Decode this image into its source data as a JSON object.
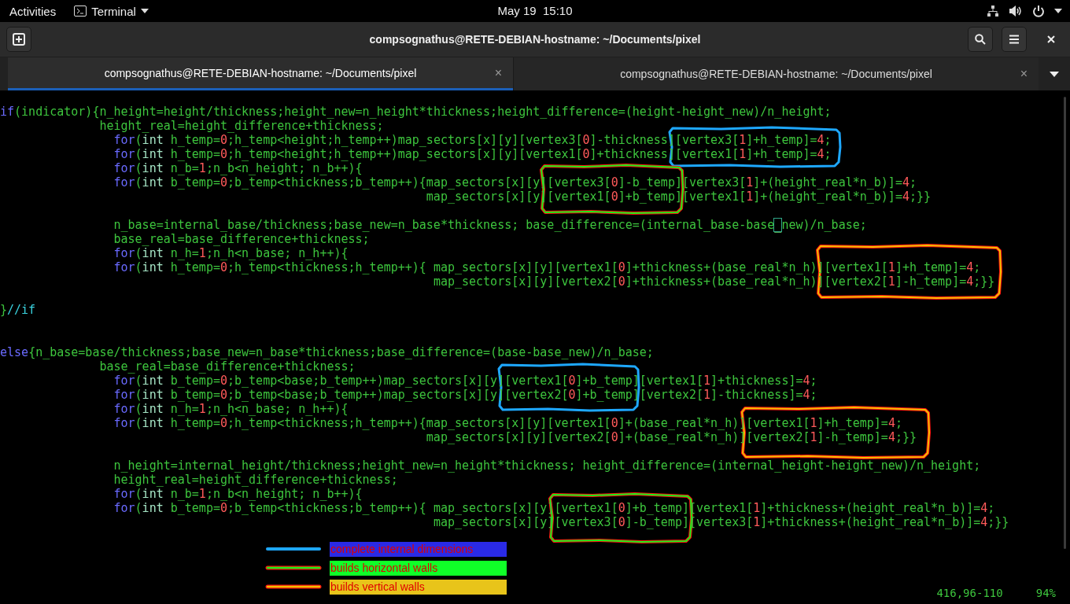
{
  "top_bar": {
    "activities": "Activities",
    "app_menu": "Terminal",
    "clock": "May 19  15:10"
  },
  "window": {
    "title": "compsognathus@RETE-DEBIAN-hostname: ~/Documents/pixel"
  },
  "tabs": [
    {
      "label": "compsognathus@RETE-DEBIAN-hostname: ~/Documents/pixel",
      "selected": true,
      "close": "×"
    },
    {
      "label": "compsognathus@RETE-DEBIAN-hostname: ~/Documents/pixel",
      "selected": false,
      "close": "×"
    }
  ],
  "code_lines": [
    {
      "kind": "top",
      "segments": [
        {
          "kind": "keyword",
          "text": "if"
        },
        {
          "kind": "plain",
          "text": "(indicator){n_height=height/thickness;height_new=n_height*thickness;height_difference=(height-height_new)/n_height;"
        }
      ]
    },
    {
      "kind": "block",
      "segments": [
        {
          "kind": "plain",
          "text": "height_real=height_difference+thickness;"
        }
      ]
    },
    {
      "kind": "statement",
      "segments": [
        {
          "kind": "keyword",
          "text": "for"
        },
        {
          "kind": "plain",
          "text": "("
        },
        {
          "kind": "type",
          "text": "int"
        },
        {
          "kind": "plain",
          "text": " h_temp="
        },
        {
          "kind": "number",
          "text": "0"
        },
        {
          "kind": "plain",
          "text": ";h_temp<height;h_temp++)map_sectors[x][y][vertex3["
        },
        {
          "kind": "number",
          "text": "0"
        },
        {
          "kind": "plain",
          "text": "]-thickness][vertex3["
        },
        {
          "kind": "number",
          "text": "1"
        },
        {
          "kind": "plain",
          "text": "]+h_temp]="
        },
        {
          "kind": "number",
          "text": "4"
        },
        {
          "kind": "plain",
          "text": ";"
        }
      ]
    },
    {
      "kind": "statement",
      "segments": [
        {
          "kind": "keyword",
          "text": "for"
        },
        {
          "kind": "plain",
          "text": "("
        },
        {
          "kind": "type",
          "text": "int"
        },
        {
          "kind": "plain",
          "text": " h_temp="
        },
        {
          "kind": "number",
          "text": "0"
        },
        {
          "kind": "plain",
          "text": ";h_temp<height;h_temp++)map_sectors[x][y][vertex1["
        },
        {
          "kind": "number",
          "text": "0"
        },
        {
          "kind": "plain",
          "text": "]+thickness][vertex1["
        },
        {
          "kind": "number",
          "text": "1"
        },
        {
          "kind": "plain",
          "text": "]+h_temp]="
        },
        {
          "kind": "number",
          "text": "4"
        },
        {
          "kind": "plain",
          "text": ";"
        }
      ]
    },
    {
      "kind": "statement",
      "segments": [
        {
          "kind": "keyword",
          "text": "for"
        },
        {
          "kind": "plain",
          "text": "("
        },
        {
          "kind": "type",
          "text": "int"
        },
        {
          "kind": "plain",
          "text": " n_b="
        },
        {
          "kind": "number",
          "text": "1"
        },
        {
          "kind": "plain",
          "text": ";n_b<n_height; n_b++){"
        }
      ]
    },
    {
      "kind": "statement",
      "segments": [
        {
          "kind": "keyword",
          "text": "for"
        },
        {
          "kind": "plain",
          "text": "("
        },
        {
          "kind": "type",
          "text": "int"
        },
        {
          "kind": "plain",
          "text": " b_temp="
        },
        {
          "kind": "number",
          "text": "0"
        },
        {
          "kind": "plain",
          "text": ";b_temp<thickness;b_temp++){map_sectors[x][y][vertex3["
        },
        {
          "kind": "number",
          "text": "0"
        },
        {
          "kind": "plain",
          "text": "]-b_temp][vertex3["
        },
        {
          "kind": "number",
          "text": "1"
        },
        {
          "kind": "plain",
          "text": "]+(height_real*n_b)]="
        },
        {
          "kind": "number",
          "text": "4"
        },
        {
          "kind": "plain",
          "text": ";"
        }
      ]
    },
    {
      "kind": "wrap",
      "segments": [
        {
          "kind": "plain",
          "text": "map_sectors[x][y][vertex1["
        },
        {
          "kind": "number",
          "text": "0"
        },
        {
          "kind": "plain",
          "text": "]+b_temp][vertex1["
        },
        {
          "kind": "number",
          "text": "1"
        },
        {
          "kind": "plain",
          "text": "]+(height_real*n_b)]="
        },
        {
          "kind": "number",
          "text": "4"
        },
        {
          "kind": "plain",
          "text": ";}}"
        }
      ]
    },
    {
      "kind": "blank"
    },
    {
      "kind": "statement",
      "segments": [
        {
          "kind": "plain",
          "text": "n_base=internal_base/thickness;base_new=n_base*thickness; base_difference=(internal_base-base"
        },
        {
          "kind": "cursor",
          "text": "_"
        },
        {
          "kind": "plain",
          "text": "new)/n_base;"
        }
      ]
    },
    {
      "kind": "statement",
      "segments": [
        {
          "kind": "plain",
          "text": "base_real=base_difference+thickness;"
        }
      ]
    },
    {
      "kind": "statement",
      "segments": [
        {
          "kind": "keyword",
          "text": "for"
        },
        {
          "kind": "plain",
          "text": "("
        },
        {
          "kind": "type",
          "text": "int"
        },
        {
          "kind": "plain",
          "text": " n_h="
        },
        {
          "kind": "number",
          "text": "1"
        },
        {
          "kind": "plain",
          "text": ";n_h<n_base; n_h++){"
        }
      ]
    },
    {
      "kind": "statement",
      "segments": [
        {
          "kind": "keyword",
          "text": "for"
        },
        {
          "kind": "plain",
          "text": "("
        },
        {
          "kind": "type",
          "text": "int"
        },
        {
          "kind": "plain",
          "text": " h_temp="
        },
        {
          "kind": "number",
          "text": "0"
        },
        {
          "kind": "plain",
          "text": ";h_temp<thickness;h_temp++){ map_sectors[x][y][vertex1["
        },
        {
          "kind": "number",
          "text": "0"
        },
        {
          "kind": "plain",
          "text": "]+thickness+(base_real*n_h)][vertex1["
        },
        {
          "kind": "number",
          "text": "1"
        },
        {
          "kind": "plain",
          "text": "]+h_temp]="
        },
        {
          "kind": "number",
          "text": "4"
        },
        {
          "kind": "plain",
          "text": ";"
        }
      ]
    },
    {
      "kind": "wrap_wide",
      "segments": [
        {
          "kind": "plain",
          "text": "map_sectors[x][y][vertex2["
        },
        {
          "kind": "number",
          "text": "0"
        },
        {
          "kind": "plain",
          "text": "]+thickness+(base_real*n_h)][vertex2["
        },
        {
          "kind": "number",
          "text": "1"
        },
        {
          "kind": "plain",
          "text": "]-h_temp]="
        },
        {
          "kind": "number",
          "text": "4"
        },
        {
          "kind": "plain",
          "text": ";}}"
        }
      ]
    },
    {
      "kind": "blank"
    },
    {
      "kind": "top",
      "segments": [
        {
          "kind": "plain",
          "text": "}"
        },
        {
          "kind": "comment",
          "text": "//if"
        }
      ]
    },
    {
      "kind": "blank"
    },
    {
      "kind": "blank"
    },
    {
      "kind": "top",
      "segments": [
        {
          "kind": "keyword",
          "text": "else"
        },
        {
          "kind": "plain",
          "text": "{n_base=base/thickness;base_new=n_base*thickness;base_difference=(base-base_new)/n_base;"
        }
      ]
    },
    {
      "kind": "block",
      "segments": [
        {
          "kind": "plain",
          "text": "base_real=base_difference+thickness;"
        }
      ]
    },
    {
      "kind": "statement",
      "segments": [
        {
          "kind": "keyword",
          "text": "for"
        },
        {
          "kind": "plain",
          "text": "("
        },
        {
          "kind": "type",
          "text": "int"
        },
        {
          "kind": "plain",
          "text": " b_temp="
        },
        {
          "kind": "number",
          "text": "0"
        },
        {
          "kind": "plain",
          "text": ";b_temp<base;b_temp++)map_sectors[x][y][vertex1["
        },
        {
          "kind": "number",
          "text": "0"
        },
        {
          "kind": "plain",
          "text": "]+b_temp][vertex1["
        },
        {
          "kind": "number",
          "text": "1"
        },
        {
          "kind": "plain",
          "text": "]+thickness]="
        },
        {
          "kind": "number",
          "text": "4"
        },
        {
          "kind": "plain",
          "text": ";"
        }
      ]
    },
    {
      "kind": "statement",
      "segments": [
        {
          "kind": "keyword",
          "text": "for"
        },
        {
          "kind": "plain",
          "text": "("
        },
        {
          "kind": "type",
          "text": "int"
        },
        {
          "kind": "plain",
          "text": " b_temp="
        },
        {
          "kind": "number",
          "text": "0"
        },
        {
          "kind": "plain",
          "text": ";b_temp<base;b_temp++)map_sectors[x][y][vertex2["
        },
        {
          "kind": "number",
          "text": "0"
        },
        {
          "kind": "plain",
          "text": "]+b_temp][vertex2["
        },
        {
          "kind": "number",
          "text": "1"
        },
        {
          "kind": "plain",
          "text": "]-thickness]="
        },
        {
          "kind": "number",
          "text": "4"
        },
        {
          "kind": "plain",
          "text": ";"
        }
      ]
    },
    {
      "kind": "statement",
      "segments": [
        {
          "kind": "keyword",
          "text": "for"
        },
        {
          "kind": "plain",
          "text": "("
        },
        {
          "kind": "type",
          "text": "int"
        },
        {
          "kind": "plain",
          "text": " n_h="
        },
        {
          "kind": "number",
          "text": "1"
        },
        {
          "kind": "plain",
          "text": ";n_h<n_base; n_h++){"
        }
      ]
    },
    {
      "kind": "statement",
      "segments": [
        {
          "kind": "keyword",
          "text": "for"
        },
        {
          "kind": "plain",
          "text": "("
        },
        {
          "kind": "type",
          "text": "int"
        },
        {
          "kind": "plain",
          "text": " h_temp="
        },
        {
          "kind": "number",
          "text": "0"
        },
        {
          "kind": "plain",
          "text": ";h_temp<thickness;h_temp++){map_sectors[x][y][vertex1["
        },
        {
          "kind": "number",
          "text": "0"
        },
        {
          "kind": "plain",
          "text": "]+(base_real*n_h)][vertex1["
        },
        {
          "kind": "number",
          "text": "1"
        },
        {
          "kind": "plain",
          "text": "]+h_temp]="
        },
        {
          "kind": "number",
          "text": "4"
        },
        {
          "kind": "plain",
          "text": ";"
        }
      ]
    },
    {
      "kind": "wrap",
      "segments": [
        {
          "kind": "plain",
          "text": "map_sectors[x][y][vertex2["
        },
        {
          "kind": "number",
          "text": "0"
        },
        {
          "kind": "plain",
          "text": "]+(base_real*n_h)][vertex2["
        },
        {
          "kind": "number",
          "text": "1"
        },
        {
          "kind": "plain",
          "text": "]-h_temp]="
        },
        {
          "kind": "number",
          "text": "4"
        },
        {
          "kind": "plain",
          "text": ";}}"
        }
      ]
    },
    {
      "kind": "blank"
    },
    {
      "kind": "statement",
      "segments": [
        {
          "kind": "plain",
          "text": "n_height=internal_height/thickness;height_new=n_height*thickness; height_difference=(internal_height-height_new)/n_height;"
        }
      ]
    },
    {
      "kind": "statement",
      "segments": [
        {
          "kind": "plain",
          "text": "height_real=height_difference+thickness;"
        }
      ]
    },
    {
      "kind": "statement",
      "segments": [
        {
          "kind": "keyword",
          "text": "for"
        },
        {
          "kind": "plain",
          "text": "("
        },
        {
          "kind": "type",
          "text": "int"
        },
        {
          "kind": "plain",
          "text": " n_b="
        },
        {
          "kind": "number",
          "text": "1"
        },
        {
          "kind": "plain",
          "text": ";n_b<n_height; n_b++){"
        }
      ]
    },
    {
      "kind": "statement",
      "segments": [
        {
          "kind": "keyword",
          "text": "for"
        },
        {
          "kind": "plain",
          "text": "("
        },
        {
          "kind": "type",
          "text": "int"
        },
        {
          "kind": "plain",
          "text": " b_temp="
        },
        {
          "kind": "number",
          "text": "0"
        },
        {
          "kind": "plain",
          "text": ";b_temp<thickness;b_temp++){ map_sectors[x][y][vertex1["
        },
        {
          "kind": "number",
          "text": "0"
        },
        {
          "kind": "plain",
          "text": "]+b_temp][vertex1["
        },
        {
          "kind": "number",
          "text": "1"
        },
        {
          "kind": "plain",
          "text": "]+thickness+(height_real*n_b)]="
        },
        {
          "kind": "number",
          "text": "4"
        },
        {
          "kind": "plain",
          "text": ";"
        }
      ]
    },
    {
      "kind": "wrap_wide",
      "segments": [
        {
          "kind": "plain",
          "text": "map_sectors[x][y][vertex3["
        },
        {
          "kind": "number",
          "text": "0"
        },
        {
          "kind": "plain",
          "text": "]-b_temp][vertex3["
        },
        {
          "kind": "number",
          "text": "1"
        },
        {
          "kind": "plain",
          "text": "]+thickness+(height_real*n_b)]="
        },
        {
          "kind": "number",
          "text": "4"
        },
        {
          "kind": "plain",
          "text": ";}}"
        }
      ]
    }
  ],
  "annotations": [
    {
      "kind": "internal"
    },
    {
      "kind": "horizontal"
    },
    {
      "kind": "vertical"
    },
    {
      "kind": "internal"
    },
    {
      "kind": "vertical"
    },
    {
      "kind": "horizontal"
    }
  ],
  "legend": [
    {
      "kind": "internal",
      "label": "complete internal dimensions",
      "color": "#1ea8ff"
    },
    {
      "kind": "horizontal",
      "label": "builds horizontal walls",
      "color": "#18f018"
    },
    {
      "kind": "vertical",
      "label": "builds vertical walls",
      "color": "#f0c000"
    }
  ],
  "status": {
    "position": "416,96-110",
    "percent": "94%"
  }
}
